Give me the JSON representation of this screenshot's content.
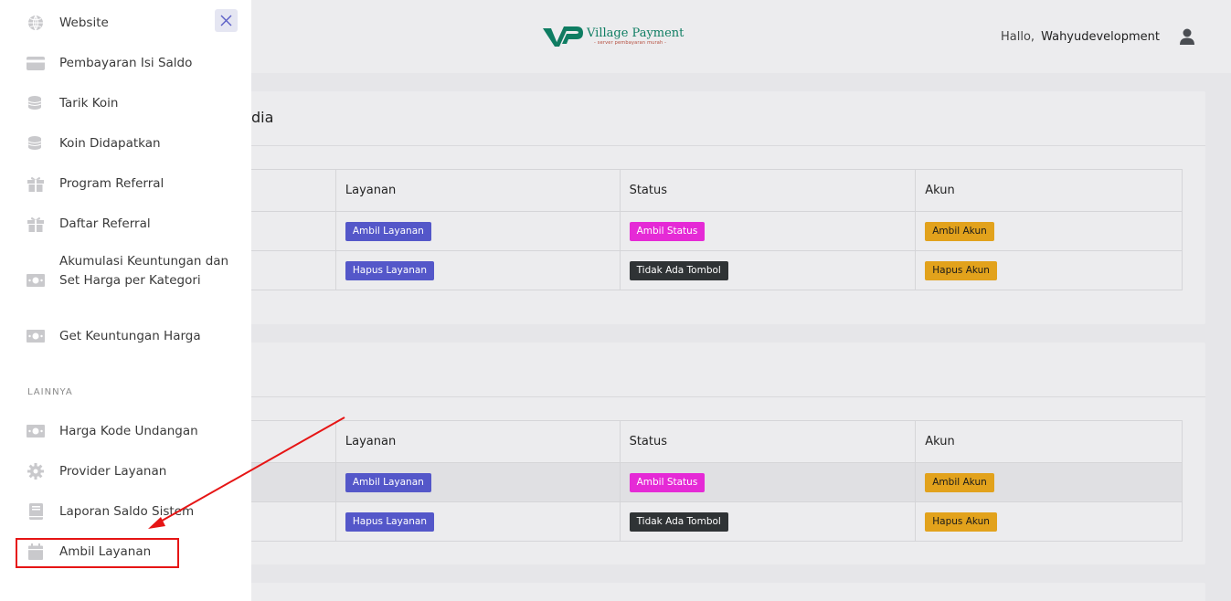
{
  "header": {
    "logo_title": "Village Payment",
    "logo_subtitle": "- server pembayaran murah -",
    "hello": "Hallo,",
    "username": "Wahyudevelopment"
  },
  "sidebar": {
    "items": [
      {
        "label": "Website",
        "icon": "globe-icon"
      },
      {
        "label": "Pembayaran Isi Saldo",
        "icon": "credit-card-icon"
      },
      {
        "label": "Tarik Koin",
        "icon": "coins-icon"
      },
      {
        "label": "Koin Didapatkan",
        "icon": "coins-icon"
      },
      {
        "label": "Program Referral",
        "icon": "gift-icon"
      },
      {
        "label": "Daftar Referral",
        "icon": "gift-icon"
      },
      {
        "label": "Akumulasi Keuntungan dan Set Harga per Kategori",
        "icon": "money-bill-icon"
      },
      {
        "label": "Get Keuntungan Harga",
        "icon": "money-bill-icon"
      }
    ],
    "section_label": "LAINNYA",
    "other_items": [
      {
        "label": "Harga Kode Undangan",
        "icon": "money-bill-icon"
      },
      {
        "label": "Provider Layanan",
        "icon": "gear-icon"
      },
      {
        "label": "Laporan Saldo Sistem",
        "icon": "book-icon"
      },
      {
        "label": "Ambil Layanan",
        "icon": "calendar-icon"
      }
    ]
  },
  "cards": [
    {
      "title": "dia",
      "headers": [
        "",
        "Layanan",
        "Status",
        "Akun"
      ],
      "rows": [
        [
          "",
          "Ambil Layanan",
          "Ambil Status",
          "Ambil Akun"
        ],
        [
          "",
          "Hapus Layanan",
          "Tidak Ada Tombol",
          "Hapus Akun"
        ]
      ]
    },
    {
      "title": "",
      "headers": [
        "",
        "Layanan",
        "Status",
        "Akun"
      ],
      "rows": [
        [
          "",
          "Ambil Layanan",
          "Ambil Status",
          "Ambil Akun"
        ],
        [
          "",
          "Hapus Layanan",
          "Tidak Ada Tombol",
          "Hapus Akun"
        ]
      ]
    }
  ],
  "colors": {
    "accent_blue": "#5457c9",
    "accent_pink": "#e52ad6",
    "dark": "#2f3335",
    "yellow": "#e2a21c",
    "brand_green": "#0e7d62",
    "annotation_red": "#e61515"
  }
}
